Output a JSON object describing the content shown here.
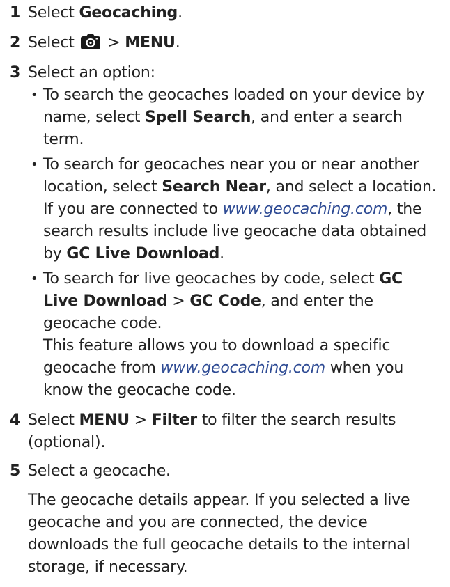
{
  "steps": [
    {
      "num": "1",
      "pre": "Select ",
      "bold": "Geocaching",
      "post": "."
    },
    {
      "num": "2",
      "pre": "Select ",
      "icon": "geocache-camera-icon",
      "mid": " > ",
      "bold": "MENU",
      "post": "."
    },
    {
      "num": "3",
      "text": "Select an option:"
    },
    {
      "num": "4",
      "pre": "Select ",
      "bold1": "MENU",
      "mid": " > ",
      "bold2": "Filter",
      "post": " to filter the search results (optional)."
    },
    {
      "num": "5",
      "text": "Select a geocache."
    }
  ],
  "options": [
    {
      "t1": "To search the geocaches loaded on your device by name, select ",
      "b1": "Spell Search",
      "t2": ", and enter a search term."
    },
    {
      "t1": "To search for geocaches near you or near another location, select ",
      "b1": "Search Near",
      "t2": ", and select a location.",
      "note_pre": "If you are connected to ",
      "note_link": "www.geocaching.com",
      "note_mid": ", the search results include live geocache data obtained by ",
      "note_bold": "GC Live Download",
      "note_post": "."
    },
    {
      "t1": "To search for live geocaches by code, select ",
      "b1": "GC Live Download",
      "mid": " > ",
      "b2": "GC Code",
      "t2": ", and enter the geocache code.",
      "note_pre": "This feature allows you to download a specific geocache from ",
      "note_link": "www.geocaching.com",
      "note_post": " when you know the geocache code."
    }
  ],
  "result_paragraph": "The geocache details appear. If you selected a live geocache and you are connected, the device downloads the full geocache details to the internal storage, if necessary.",
  "colors": {
    "text": "#222222",
    "link": "#2e4b94"
  }
}
